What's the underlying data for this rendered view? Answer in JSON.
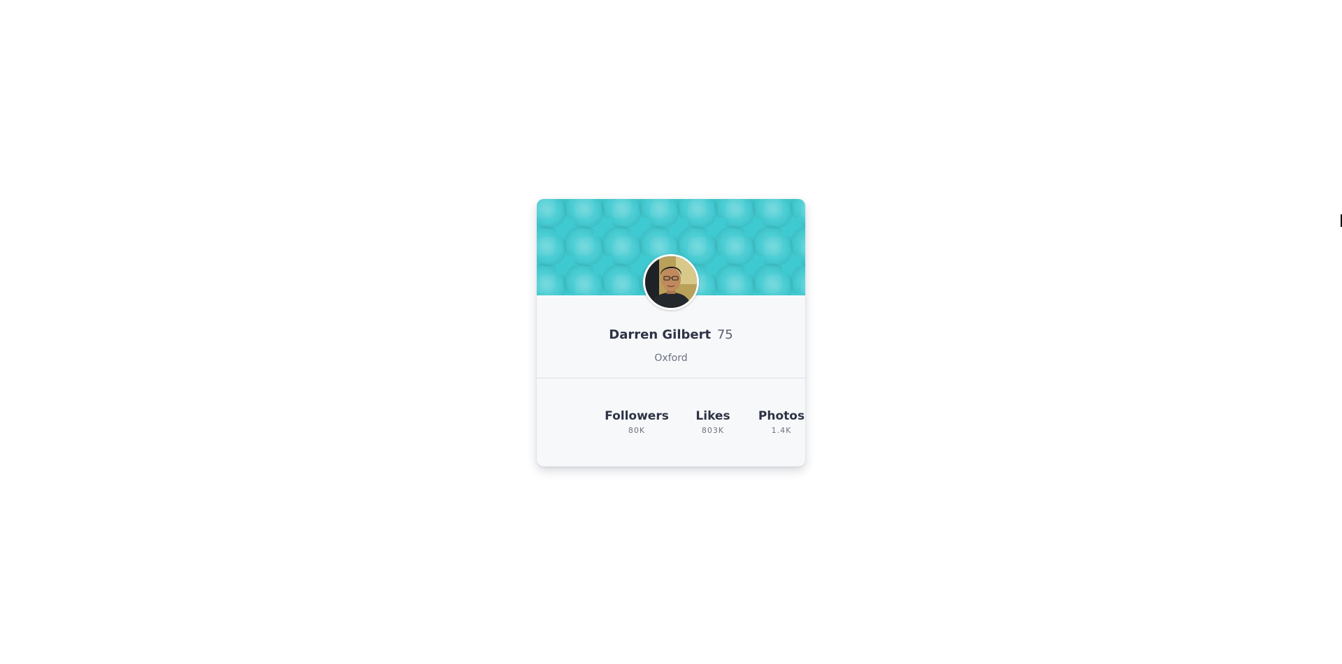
{
  "profile_card": {
    "name": "Darren Gilbert",
    "age": "75",
    "city": "Oxford",
    "avatar": "avatar-photo",
    "banner_color": "#3fcad1",
    "stats": [
      {
        "label": "Followers",
        "value": "80K"
      },
      {
        "label": "Likes",
        "value": "803K"
      },
      {
        "label": "Photos",
        "value": "1.4K"
      }
    ]
  }
}
